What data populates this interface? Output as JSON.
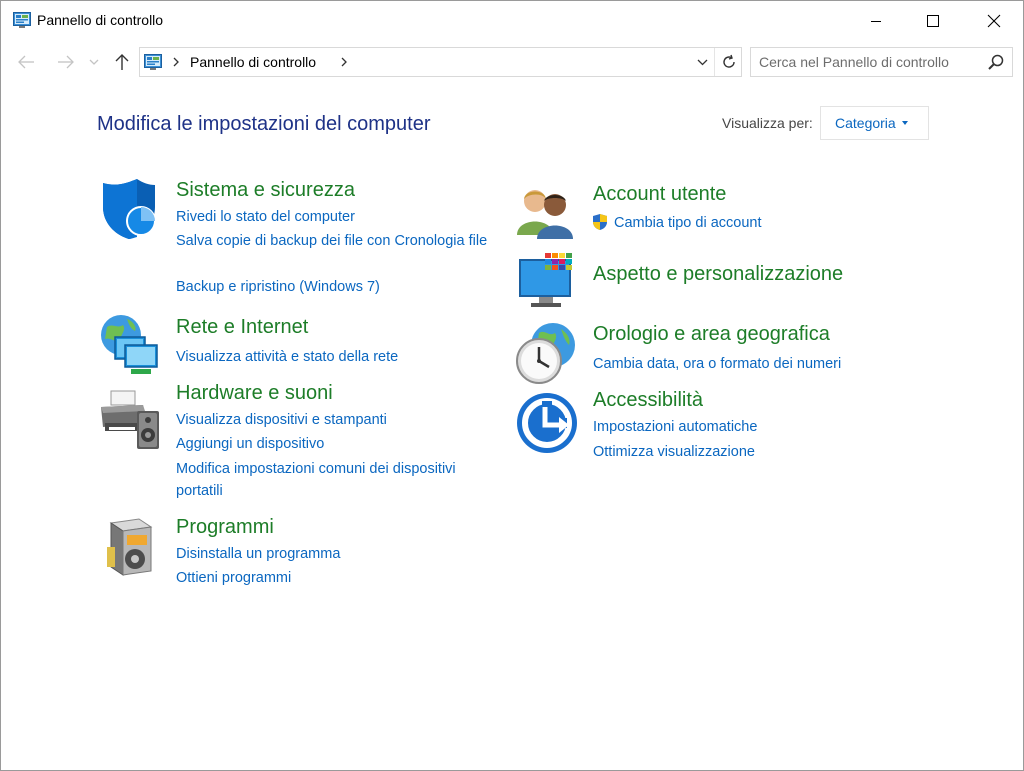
{
  "window": {
    "title": "Pannello di controllo"
  },
  "address": {
    "crumb": "Pannello di controllo"
  },
  "search": {
    "placeholder": "Cerca nel Pannello di controllo"
  },
  "main": {
    "heading": "Modifica le impostazioni del computer",
    "view_by_label": "Visualizza per:",
    "view_by_value": "Categoria"
  },
  "categories": {
    "system": {
      "title": "Sistema e sicurezza",
      "links": [
        "Rivedi lo stato del computer",
        "Salva copie di backup dei file con Cronologia file",
        "Backup e ripristino (Windows 7)"
      ]
    },
    "network": {
      "title": "Rete e Internet",
      "links": [
        "Visualizza attività e stato della rete"
      ]
    },
    "hardware": {
      "title": "Hardware e suoni",
      "links": [
        "Visualizza dispositivi e stampanti",
        "Aggiungi un dispositivo",
        "Modifica impostazioni comuni dei dispositivi portatili"
      ]
    },
    "programs": {
      "title": "Programmi",
      "links": [
        "Disinstalla un programma",
        "Ottieni programmi"
      ]
    },
    "accounts": {
      "title": "Account utente",
      "links": [
        "Cambia tipo di account"
      ]
    },
    "appearance": {
      "title": "Aspetto e personalizzazione"
    },
    "clock": {
      "title": "Orologio e area geografica",
      "links": [
        "Cambia data, ora o formato dei numeri"
      ]
    },
    "ease": {
      "title": "Accessibilità",
      "links": [
        "Impostazioni automatiche",
        "Ottimizza visualizzazione"
      ]
    }
  },
  "icons": {
    "title": "control-panel-icon",
    "minimize": "minimize-icon",
    "maximize": "maximize-icon",
    "close": "close-icon",
    "back": "arrow-left-icon",
    "forward": "arrow-right-icon",
    "recent": "chevron-down-icon",
    "up": "arrow-up-icon",
    "refresh": "refresh-icon",
    "search": "search-icon"
  },
  "colors": {
    "heading": "#1e3287",
    "category_title": "#1d7d28",
    "link": "#0b67c0"
  }
}
